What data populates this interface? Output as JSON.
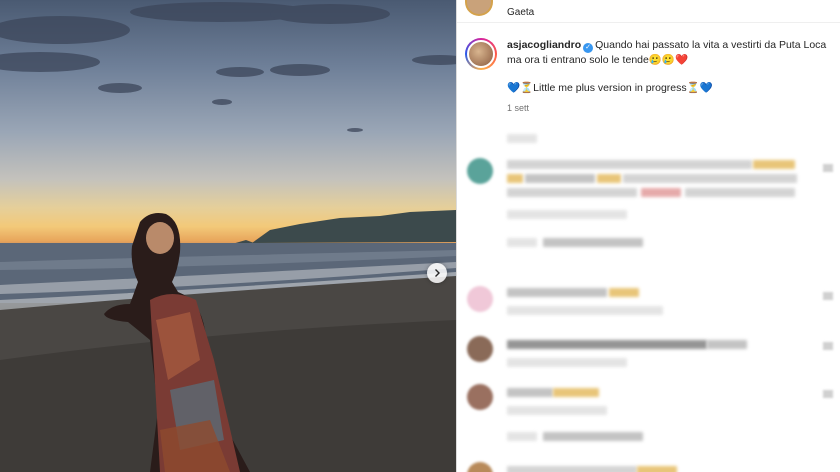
{
  "post": {
    "location": "Gaeta",
    "username": "asjacogliandro",
    "verified_icon": "verified-badge-icon",
    "caption_line1": "Quando hai passato la vita a vestirti da Puta Loca ma ora ti entrano solo le tende🥲🥲❤️",
    "caption_line2": "💙⏳Little me plus version in progress⏳💙",
    "timestamp": "1 sett",
    "carousel_icon": "chevron-right-icon"
  },
  "colors": {
    "accent": "#3897f0",
    "text": "#262626",
    "muted": "#737373"
  }
}
